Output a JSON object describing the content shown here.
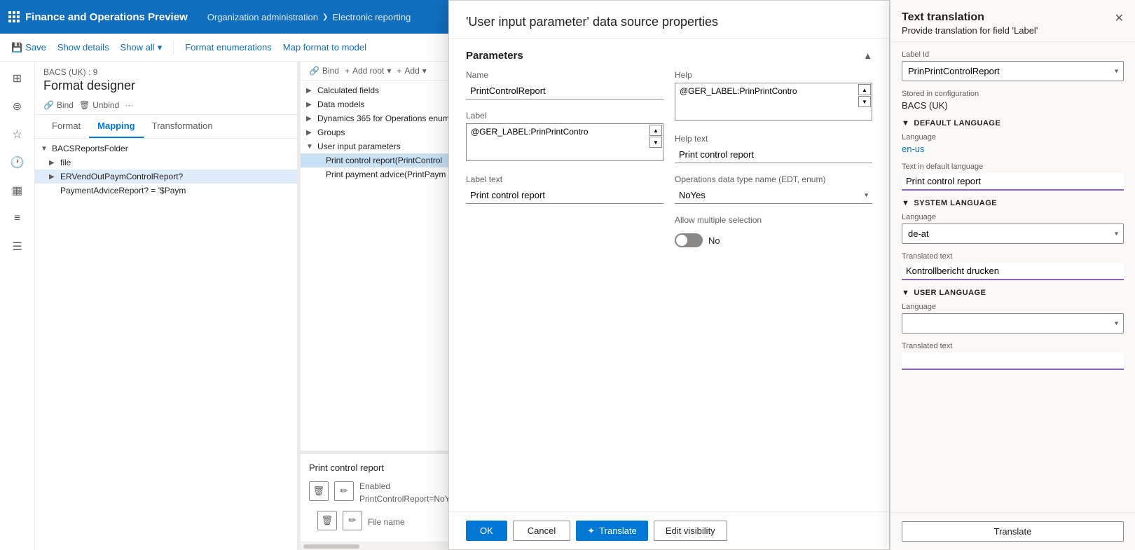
{
  "app": {
    "title": "Finance and Operations Preview",
    "nav": {
      "item1": "Organization administration",
      "chevron": "❯",
      "item2": "Electronic reporting"
    }
  },
  "toolbar": {
    "save": "Save",
    "show_details": "Show details",
    "show_all": "Show all",
    "format_enumerations": "Format enumerations",
    "map_format": "Map format to model"
  },
  "designer": {
    "breadcrumb": "BACS (UK) : 9",
    "title": "Format designer",
    "bind": "Bind",
    "unbind": "Unbind",
    "tabs": [
      "Format",
      "Mapping",
      "Transformation"
    ],
    "active_tab": "Mapping",
    "tree": [
      {
        "label": "BACSReportsFolder",
        "level": 0,
        "hasChildren": true,
        "expanded": true
      },
      {
        "label": "file",
        "level": 1,
        "hasChildren": true,
        "expanded": false
      },
      {
        "label": "ERVendOutPaymControlReport?",
        "level": 1,
        "hasChildren": true,
        "expanded": false,
        "selected": true
      },
      {
        "label": "PaymentAdviceReport? = '$Paym",
        "level": 1,
        "hasChildren": false
      }
    ]
  },
  "right_tree": {
    "bind": "Bind",
    "add_root": "Add root",
    "add": "Add",
    "items": [
      {
        "label": "Calculated fields",
        "level": 0,
        "hasChildren": true
      },
      {
        "label": "Data models",
        "level": 0,
        "hasChildren": true
      },
      {
        "label": "Dynamics 365 for Operations enum",
        "level": 0,
        "hasChildren": true
      },
      {
        "label": "Groups",
        "level": 0,
        "hasChildren": true
      },
      {
        "label": "User input parameters",
        "level": 0,
        "hasChildren": true,
        "expanded": true
      },
      {
        "label": "Print control report(PrintControl",
        "level": 1,
        "highlighted": true
      },
      {
        "label": "Print payment advice(PrintPaym",
        "level": 1
      }
    ]
  },
  "bottom_preview": {
    "label": "Print control report",
    "enabled_label": "Enabled",
    "enabled_value": "PrintControlReport=NoYes.",
    "file_name": "File name"
  },
  "modal": {
    "title": "'User input parameter' data source properties",
    "parameters_section": "Parameters",
    "fields": {
      "name_label": "Name",
      "name_value": "PrintControlReport",
      "label_label": "Label",
      "label_value": "@GER_LABEL:PrinPrintContro",
      "label_text_label": "Label text",
      "label_text_value": "Print control report",
      "help_label": "Help",
      "help_value": "@GER_LABEL:PrinPrintContro",
      "help_text_label": "Help text",
      "help_text_value": "Print control report",
      "ops_type_label": "Operations data type name (EDT, enum)",
      "ops_type_value": "NoYes",
      "allow_multiple_label": "Allow multiple selection",
      "allow_multiple_value": "No"
    },
    "buttons": {
      "ok": "OK",
      "cancel": "Cancel",
      "translate": "Translate",
      "edit_visibility": "Edit visibility"
    }
  },
  "translation_panel": {
    "title": "Text translation",
    "subtitle": "Provide translation for field 'Label'",
    "close_icon": "✕",
    "label_id_label": "Label Id",
    "label_id_value": "PrinPrintControlReport",
    "stored_label": "Stored in configuration",
    "stored_value": "BACS (UK)",
    "default_lang_section": "DEFAULT LANGUAGE",
    "language_label": "Language",
    "default_language_value": "en-us",
    "text_default_label": "Text in default language",
    "text_default_value": "Print control report",
    "system_lang_section": "SYSTEM LANGUAGE",
    "system_language_value": "de-at",
    "translated_text_label": "Translated text",
    "translated_text_value": "Kontrollbericht drucken",
    "user_lang_section": "USER LANGUAGE",
    "user_language_value": "",
    "user_translated_value": "",
    "translate_btn": "Translate"
  }
}
